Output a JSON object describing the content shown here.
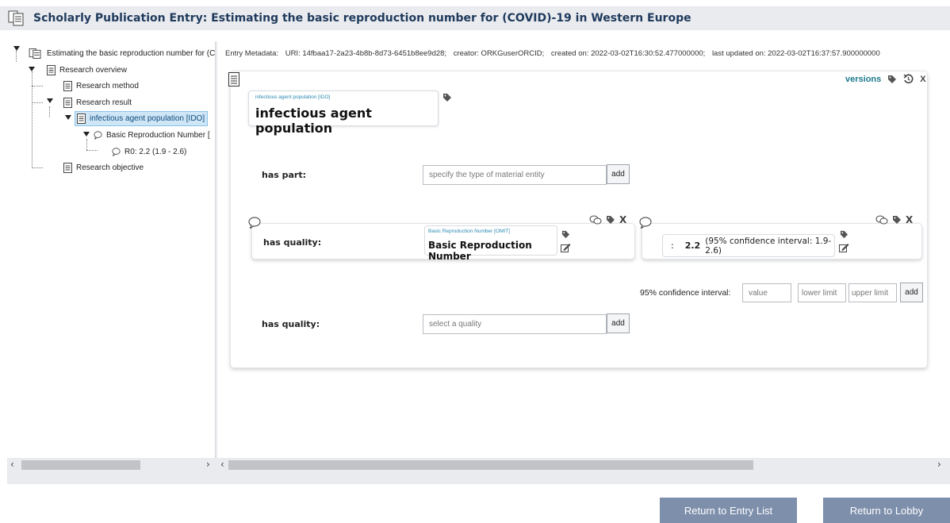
{
  "header": {
    "title": "Scholarly Publication Entry: Estimating the basic reproduction number for (COVID)-19 in Western Europe"
  },
  "tree": {
    "root": "Estimating the basic reproduction number for (C",
    "overview": "Research overview",
    "method": "Research method",
    "result": "Research result",
    "agent": "infectious agent population [IDO]",
    "brn": "Basic Reproduction Number [",
    "r0": "R0: 2.2 (1.9 - 2.6)",
    "objective": "Research objective"
  },
  "meta": {
    "label": "Entry Metadata:",
    "uri": "URI: 14fbaa17-2a23-4b8b-8d73-6451b8ee9d28;",
    "creator": "creator: ORKGuserORCID;",
    "created": "created on: 2022-03-02T16:30:52.477000000;",
    "updated": "last updated on: 2022-03-02T16:37:57.900000000"
  },
  "card": {
    "versions_label": "versions",
    "close_label": "X",
    "resource_type": "infectious agent population [IDO]",
    "resource_name": "infectious agent population",
    "has_part_label": "has part:",
    "has_part_placeholder": "specify the type of material entity",
    "add_label": "add",
    "has_quality_label": "has quality:",
    "quality_type": "Basic Reproduction Number [OMIT]",
    "quality_name": "Basic Reproduction Number",
    "value_colon": ":",
    "value_main": "2.2",
    "value_ci": "(95% confidence interval: 1.9-2.6)",
    "ci_label": "95% confidence interval:",
    "ci_value_placeholder": "value",
    "ci_lower_placeholder": "lower limit",
    "ci_upper_placeholder": "upper limit",
    "has_quality2_label": "has quality:",
    "select_quality_placeholder": "select a quality"
  },
  "buttons": {
    "return_entry_list": "Return to Entry List",
    "return_lobby": "Return to Lobby"
  },
  "colors": {
    "accent": "#1d7a8c",
    "button_bg": "#7d8fab",
    "panel_bg": "#e9ebef"
  }
}
